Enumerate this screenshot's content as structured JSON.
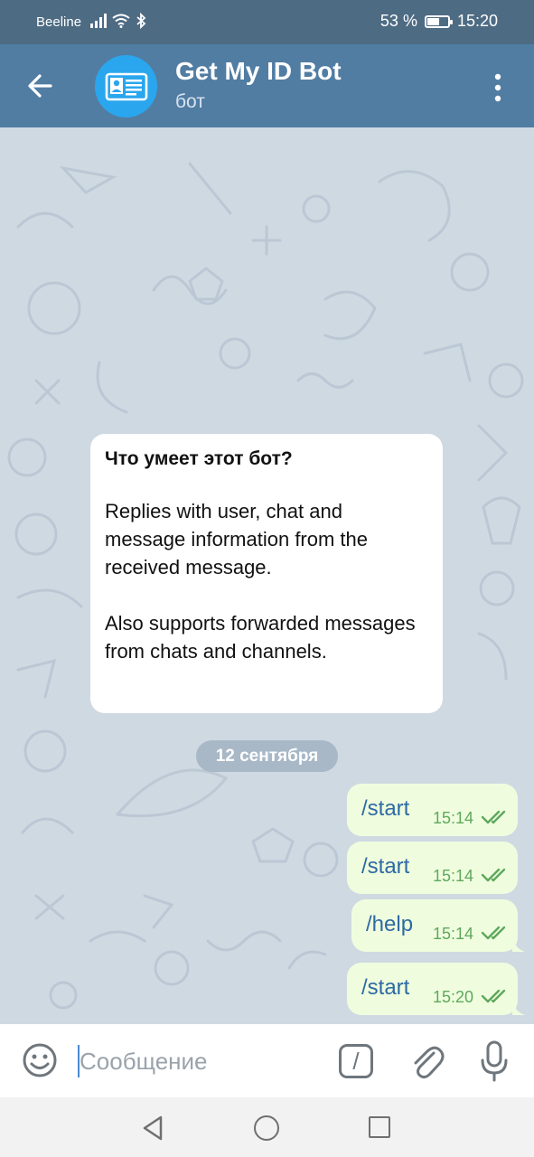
{
  "status_bar": {
    "carrier": "Beeline",
    "battery_text": "53 %",
    "battery_level": 0.53,
    "time": "15:20"
  },
  "header": {
    "title": "Get My ID Bot",
    "subtitle": "бот",
    "avatar_color": "#2aa6ee"
  },
  "bot_info": {
    "title": "Что умеет этот бот?",
    "paragraph1": "Replies with user, chat and message information from the received message.",
    "paragraph2": "Also supports forwarded messages from chats and channels."
  },
  "date_separator": "12 сентября",
  "messages": [
    {
      "text": "/start",
      "time": "15:14"
    },
    {
      "text": "/start",
      "time": "15:14"
    },
    {
      "text": "/help",
      "time": "15:14"
    },
    {
      "text": "/start",
      "time": "15:20"
    }
  ],
  "input": {
    "placeholder": "Сообщение",
    "command_glyph": "/"
  },
  "colors": {
    "header": "#527da3",
    "status_bar": "#4e6b84",
    "chat_bg": "#cfd9e2",
    "outgoing_bubble": "#effdde",
    "command_text": "#2d6aa3",
    "read_check": "#5fa85d"
  }
}
